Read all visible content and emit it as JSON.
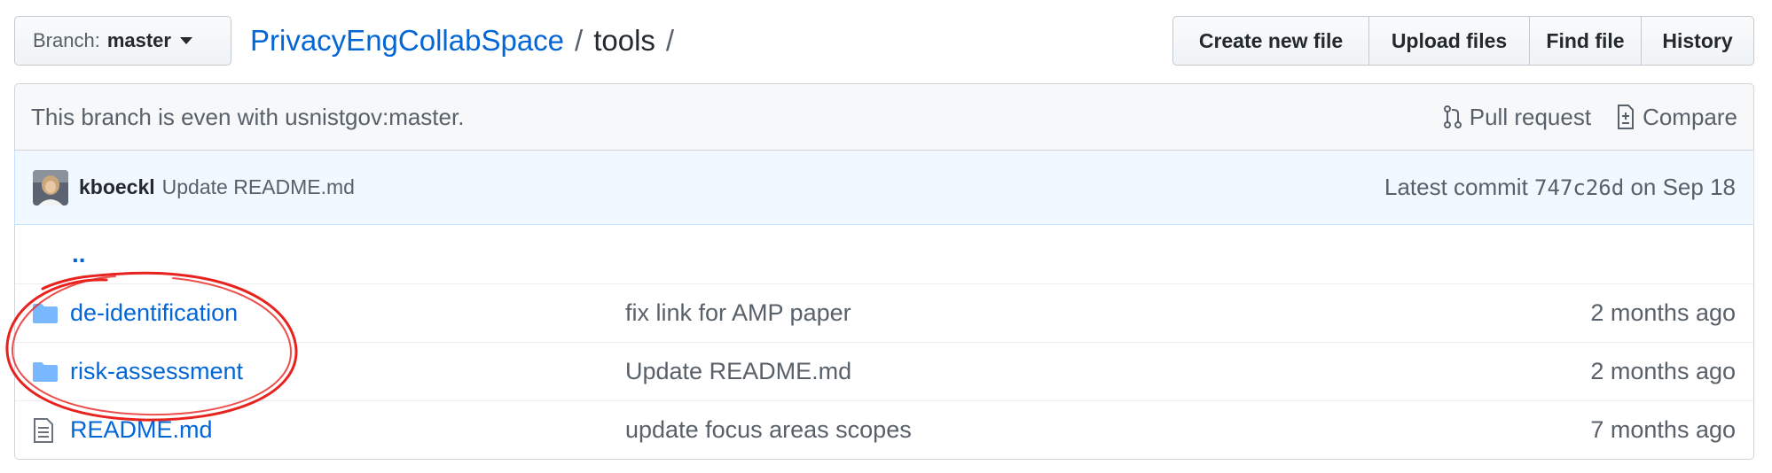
{
  "branch": {
    "label": "Branch:",
    "name": "master"
  },
  "breadcrumb": {
    "repo": "PrivacyEngCollabSpace",
    "sep1": "/",
    "folder": "tools",
    "sep2": "/"
  },
  "actions": [
    {
      "label": "Create new file"
    },
    {
      "label": "Upload files"
    },
    {
      "label": "Find file"
    },
    {
      "label": "History"
    }
  ],
  "branch_info": {
    "message": "This branch is even with usnistgov:master.",
    "pull_request": "Pull request",
    "compare": "Compare"
  },
  "commit": {
    "author": "kboeckl",
    "message": "Update README.md",
    "latest_label": "Latest commit",
    "sha": "747c26d",
    "date": "on Sep 18"
  },
  "files": {
    "up": "..",
    "rows": [
      {
        "type": "folder",
        "name": "de-identification",
        "message": "fix link for AMP paper",
        "age": "2 months ago"
      },
      {
        "type": "folder",
        "name": "risk-assessment",
        "message": "Update README.md",
        "age": "2 months ago"
      },
      {
        "type": "file",
        "name": "README.md",
        "message": "update focus areas scopes",
        "age": "7 months ago"
      }
    ]
  },
  "colors": {
    "link": "#0366d6",
    "annotation": "#e8221f",
    "folder": "#79b8ff"
  }
}
